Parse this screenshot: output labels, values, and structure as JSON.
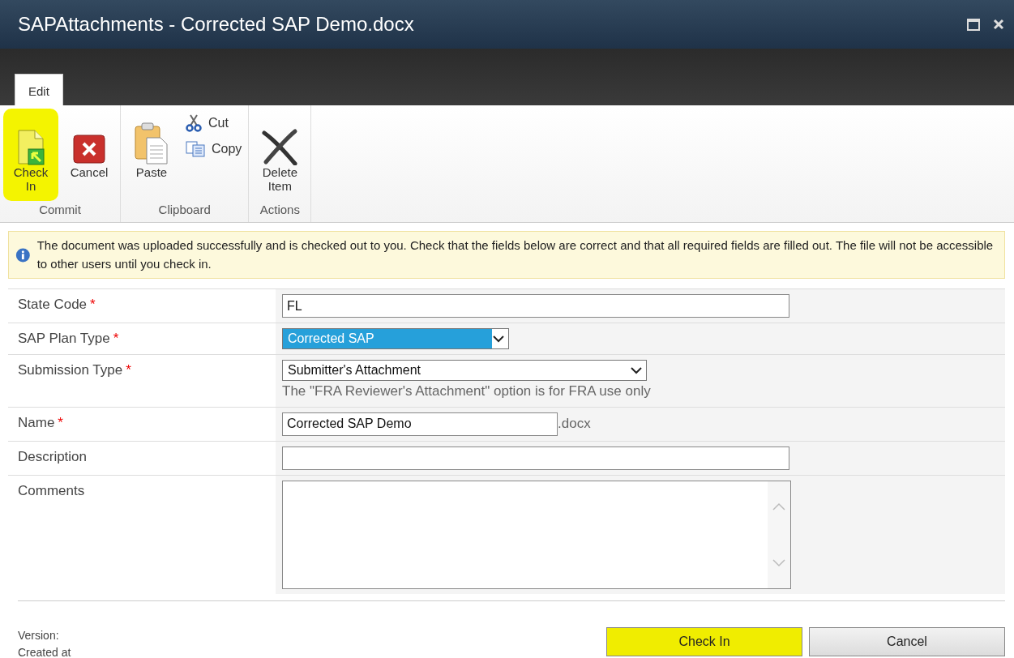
{
  "window": {
    "title": "SAPAttachments - Corrected SAP Demo.docx"
  },
  "ribbon": {
    "tabs": [
      {
        "label": "Edit",
        "selected": true
      }
    ],
    "groups": [
      {
        "label": "Commit",
        "items": [
          {
            "kind": "large",
            "label": "Check In",
            "highlighted": true
          },
          {
            "kind": "large",
            "label": "Cancel",
            "highlighted": false
          }
        ]
      },
      {
        "label": "Clipboard",
        "items": [
          {
            "kind": "large",
            "label": "Paste",
            "highlighted": false
          },
          {
            "kind": "small",
            "label": "Cut",
            "highlighted": false
          },
          {
            "kind": "small",
            "label": "Copy",
            "highlighted": false
          }
        ]
      },
      {
        "label": "Actions",
        "items": [
          {
            "kind": "large",
            "label": "Delete Item",
            "highlighted": false
          }
        ]
      }
    ]
  },
  "notice": {
    "text": "The document was uploaded successfully and is checked out to you. Check that the fields below are correct and that all required fields are filled out. The file will not be accessible to other users until you check in."
  },
  "fields": [
    {
      "label": "State Code",
      "required_mark": "*",
      "kind": "text",
      "value": "FL"
    },
    {
      "label": "SAP Plan Type",
      "required_mark": "*",
      "kind": "select",
      "value": "Corrected SAP",
      "focused": true
    },
    {
      "label": "Submission Type",
      "required_mark": "*",
      "kind": "select",
      "value": "Submitter's Attachment",
      "focused": false,
      "hint": "The \"FRA Reviewer's Attachment\" option is for FRA use only"
    },
    {
      "label": "Name",
      "required_mark": "*",
      "kind": "text",
      "value": "Corrected SAP Demo",
      "suffix": ".docx"
    },
    {
      "label": "Description",
      "kind": "text"
    },
    {
      "label": "Comments",
      "kind": "textarea"
    }
  ],
  "footer": {
    "info": [
      "Version:",
      "Created at"
    ],
    "buttons": [
      {
        "label": "Check In",
        "highlighted": true
      },
      {
        "label": "Cancel",
        "highlighted": false
      }
    ]
  }
}
